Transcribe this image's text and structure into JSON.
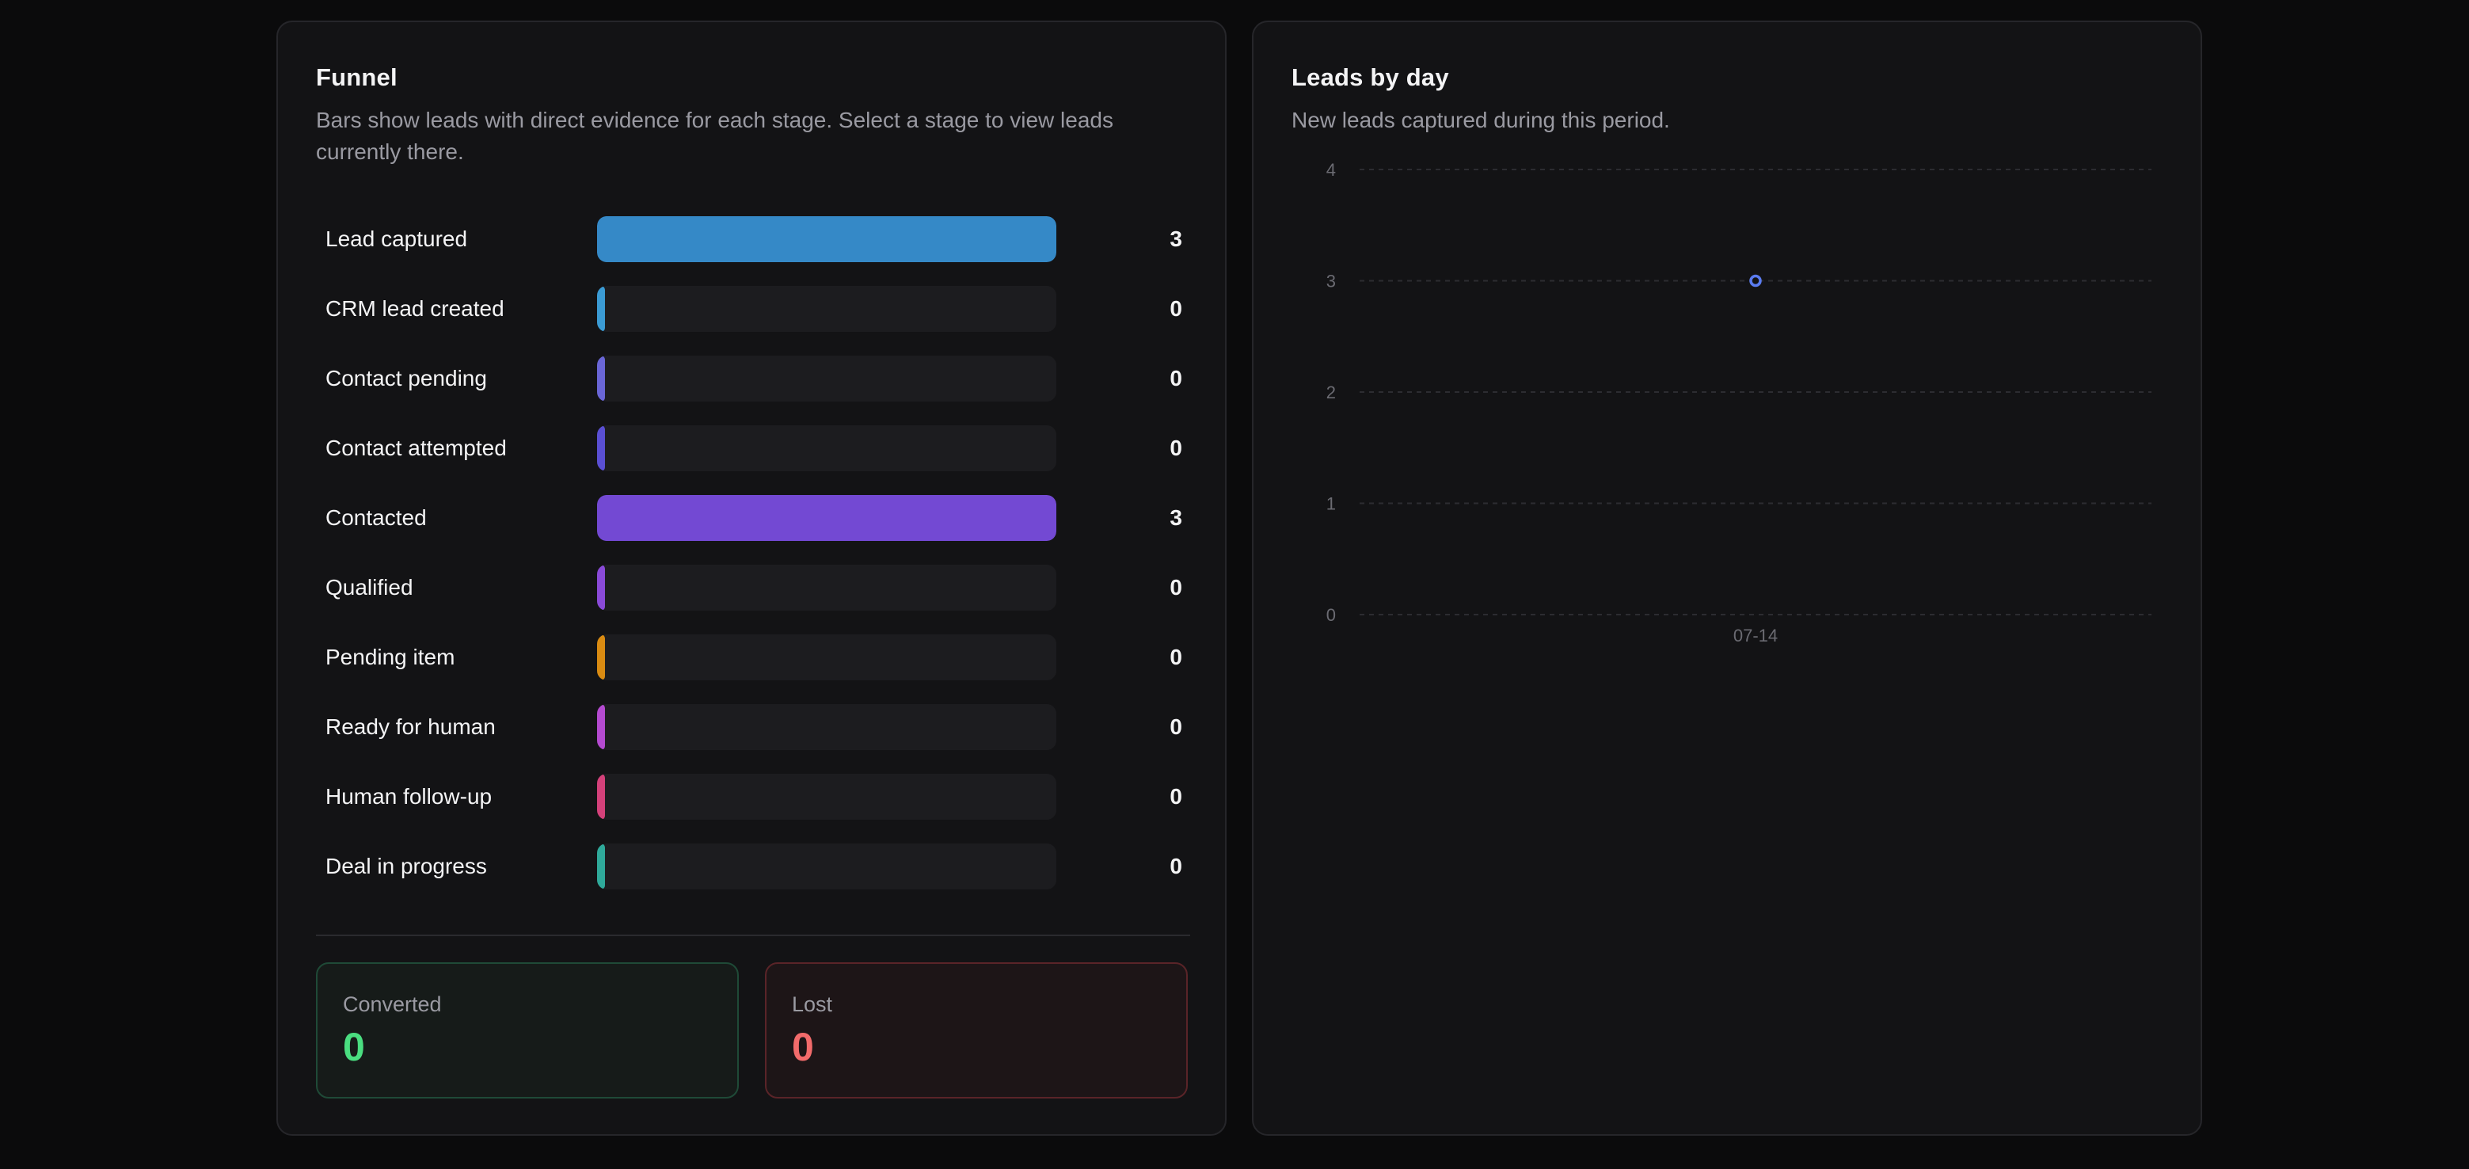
{
  "funnel": {
    "title": "Funnel",
    "description": "Bars show leads with direct evidence for each stage. Select a stage to view leads currently there.",
    "max": 3,
    "stages": [
      {
        "label": "Lead captured",
        "value": 3,
        "color": "#3589c7"
      },
      {
        "label": "CRM lead created",
        "value": 0,
        "color": "#3b9bd4"
      },
      {
        "label": "Contact pending",
        "value": 0,
        "color": "#6a66d6"
      },
      {
        "label": "Contact attempted",
        "value": 0,
        "color": "#5a4fd3"
      },
      {
        "label": "Contacted",
        "value": 3,
        "color": "#7349d3"
      },
      {
        "label": "Qualified",
        "value": 0,
        "color": "#8a4ad8"
      },
      {
        "label": "Pending item",
        "value": 0,
        "color": "#d98b12"
      },
      {
        "label": "Ready for human",
        "value": 0,
        "color": "#b44ad0"
      },
      {
        "label": "Human follow-up",
        "value": 0,
        "color": "#d4417a"
      },
      {
        "label": "Deal in progress",
        "value": 0,
        "color": "#2fa99a"
      }
    ],
    "converted": {
      "label": "Converted",
      "value": "0",
      "color": "#4ade80"
    },
    "lost": {
      "label": "Lost",
      "value": "0",
      "color": "#f26b6b"
    }
  },
  "leads_by_day": {
    "title": "Leads by day",
    "description": "New leads captured during this period.",
    "chart_data": {
      "type": "scatter",
      "title": "Leads by day",
      "x": [
        "07-14"
      ],
      "y": [
        3
      ],
      "ylim": [
        0,
        4
      ],
      "yticks": [
        "0",
        "1",
        "2",
        "3",
        "4"
      ],
      "grid": true,
      "point_color": "#5b7cf0"
    }
  }
}
